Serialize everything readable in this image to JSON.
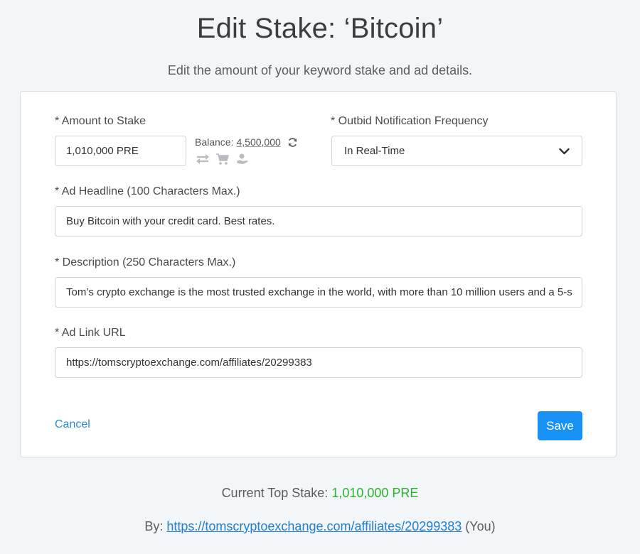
{
  "header": {
    "title": "Edit Stake: ‘Bitcoin’",
    "subtitle": "Edit the amount of your keyword stake and ad details."
  },
  "form": {
    "amount": {
      "label": "* Amount to Stake",
      "value": "1,010,000 PRE"
    },
    "balance": {
      "label": "Balance:",
      "value": "4,500,000",
      "icons": [
        "refresh-icon",
        "transfer-icon",
        "cart-icon",
        "deposit-icon"
      ]
    },
    "frequency": {
      "label": "* Outbid Notification Frequency",
      "selected": "In Real-Time"
    },
    "headline": {
      "label": "* Ad Headline (100 Characters Max.)",
      "value": "Buy Bitcoin with your credit card. Best rates."
    },
    "description": {
      "label": "* Description (250 Characters Max.)",
      "value": "Tom’s crypto exchange is the most trusted exchange in the world, with more than 10 million users and a 5-s"
    },
    "link": {
      "label": "* Ad Link URL",
      "value": "https://tomscryptoexchange.com/affiliates/20299383"
    },
    "cancel_label": "Cancel",
    "save_label": "Save"
  },
  "footer": {
    "top_stake_label": "Current Top Stake:",
    "top_stake_value": "1,010,000 PRE",
    "by_label": "By:",
    "by_link": "https://tomscryptoexchange.com/affiliates/20299383",
    "by_suffix": "(You)"
  },
  "colors": {
    "accent": "#1891f5",
    "link": "#1f7fd6",
    "amount_green": "#2bb32b",
    "background": "#f3f6f9"
  }
}
